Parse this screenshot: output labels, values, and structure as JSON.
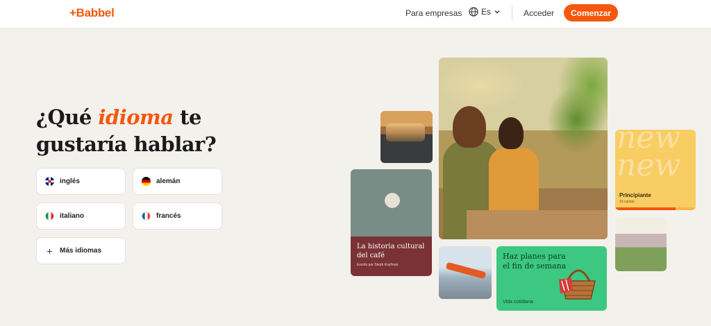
{
  "header": {
    "logo": "+Babbel",
    "business_link": "Para empresas",
    "language": "Es",
    "login": "Acceder",
    "cta": "Comenzar"
  },
  "hero": {
    "title_pre": "¿Qué ",
    "title_accent": "idioma",
    "title_post": " te",
    "title_line2": "gustaría hablar?"
  },
  "languages": [
    {
      "label": "inglés",
      "flag": "uk-flag-icon"
    },
    {
      "label": "alemán",
      "flag": "germany-flag-icon"
    },
    {
      "label": "italiano",
      "flag": "italy-flag-icon"
    },
    {
      "label": "francés",
      "flag": "france-flag-icon"
    }
  ],
  "more_languages": "Más idiomas",
  "cards": {
    "cafe": {
      "title": "La historia cultural del café",
      "subtitle": "Escrito por Steph Koyfman"
    },
    "plans": {
      "title": "Haz planes para el fin de semana",
      "tag": "Vida cotidiana"
    },
    "new": {
      "bg_word": "new new",
      "title": "Principiante",
      "subtitle": "10 cursos",
      "progress": 0.75
    }
  },
  "colors": {
    "brand": "#f5570c",
    "background": "#f3f1ec",
    "cafe_card": "#7a3236",
    "plans_card": "#3cc880",
    "new_card": "#f8cd63"
  }
}
